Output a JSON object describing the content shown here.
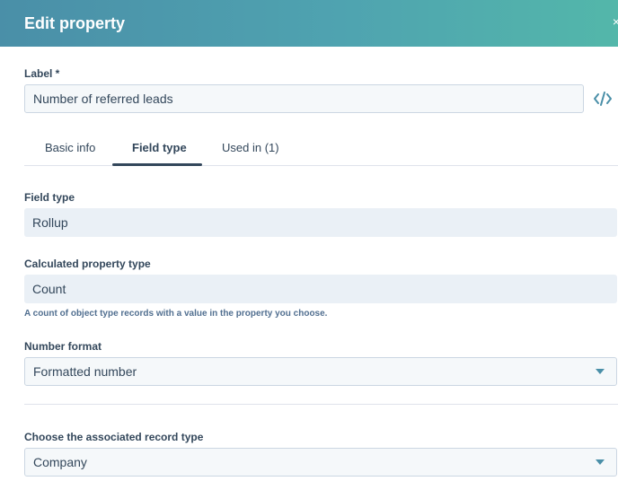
{
  "header": {
    "title": "Edit property",
    "close_glyph": "×"
  },
  "label_field": {
    "label": "Label *",
    "value": "Number of referred leads",
    "code_icon": "code-icon"
  },
  "tabs": [
    {
      "label": "Basic info",
      "active": false
    },
    {
      "label": "Field type",
      "active": true
    },
    {
      "label": "Used in (1)",
      "active": false
    }
  ],
  "field_type": {
    "label": "Field type",
    "value": "Rollup"
  },
  "calculated_type": {
    "label": "Calculated property type",
    "value": "Count",
    "help": "A count of object type records with a value in the property you choose."
  },
  "number_format": {
    "label": "Number format",
    "value": "Formatted number"
  },
  "associated_record": {
    "label": "Choose the associated record type",
    "value": "Company"
  },
  "colors": {
    "accent": "#4a8fa8",
    "text": "#33475b",
    "field_bg": "#f5f8fa",
    "readonly_bg": "#eaf0f6"
  }
}
